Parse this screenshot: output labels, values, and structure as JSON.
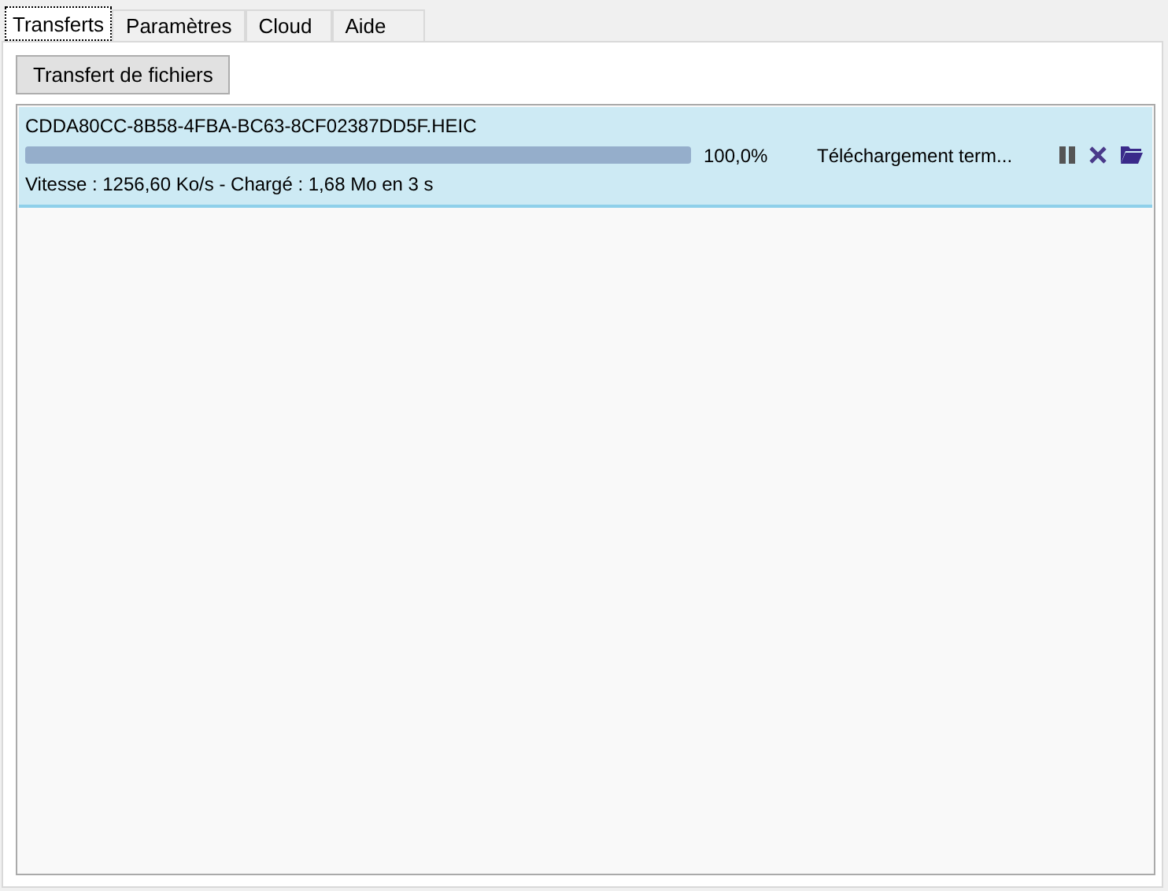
{
  "tabs": [
    {
      "label": "Transferts",
      "selected": true
    },
    {
      "label": "Paramètres",
      "selected": false
    },
    {
      "label": "Cloud",
      "selected": false
    },
    {
      "label": "Aide",
      "selected": false
    }
  ],
  "button": "Transfert de fichiers",
  "transfers": [
    {
      "filename": "CDDA80CC-8B58-4FBA-BC63-8CF02387DD5F.HEIC",
      "level": 1,
      "percent": "100,0%",
      "status": "Téléchargement term...",
      "details": "Vitesse : 1256,60 Ko/s - Chargé : 1,68 Mo en 3 s",
      "selected": true
    }
  ]
}
